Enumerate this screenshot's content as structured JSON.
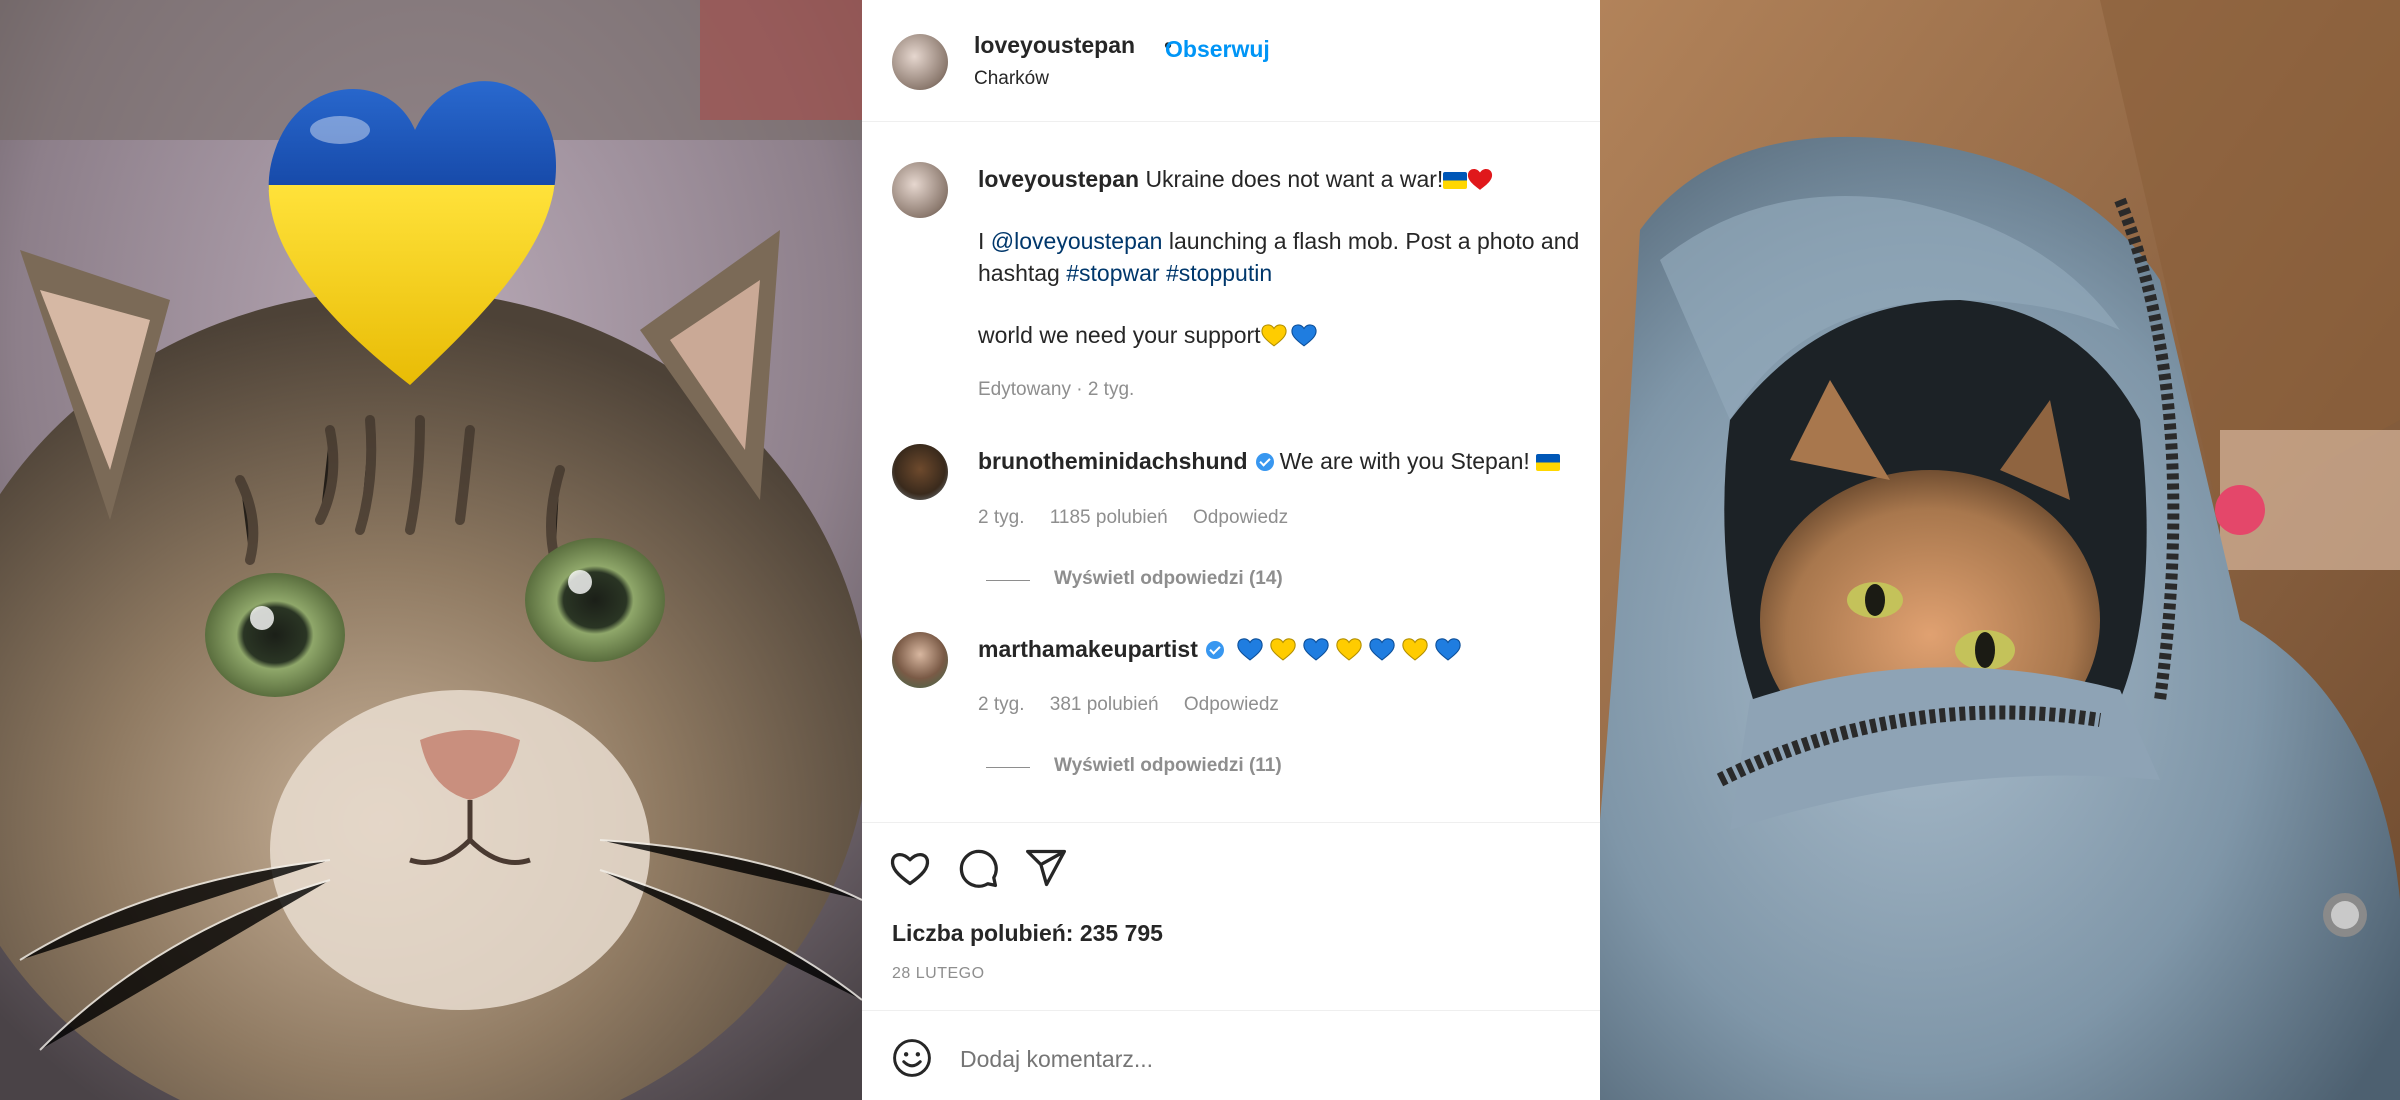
{
  "post": {
    "username": "loveyoustepan",
    "follow_label": "Obserwuj",
    "location": "Charków",
    "caption_line1": "Ukraine does not want a war!",
    "caption_line2_prefix": "I",
    "caption_mention": "@loveyoustepan",
    "caption_line2_rest": "launching a flash mob. Post a photo and",
    "caption_line3_prefix": "hashtag",
    "hashtag1": "#stopwar",
    "hashtag2": "#stopputin",
    "caption_line4": "world we need your support",
    "edited_meta": "Edytowany · 2 tyg."
  },
  "comments": [
    {
      "username": "brunotheminidachshund",
      "verified": true,
      "text": "We are with you Stepan!",
      "time": "2 tyg.",
      "likes": "1185 polubień",
      "reply_label": "Odpowiedz",
      "view_replies": "Wyświetl odpowiedzi (14)"
    },
    {
      "username": "marthamakeupartist",
      "verified": true,
      "text": "",
      "time": "2 tyg.",
      "likes": "381 polubień",
      "reply_label": "Odpowiedz",
      "view_replies": "Wyświetl odpowiedzi (11)"
    }
  ],
  "footer": {
    "likes_count": "Liczba polubień: 235 795",
    "date": "28 LUTEGO",
    "comment_placeholder": "Dodaj komentarz..."
  },
  "colors": {
    "ukraine_blue": "#0057b7",
    "ukraine_yellow": "#ffd700",
    "link": "#00376b",
    "action_blue": "#0095f6"
  },
  "icons": [
    "heart-icon",
    "comment-icon",
    "share-icon",
    "emoji-icon",
    "verified-icon"
  ]
}
